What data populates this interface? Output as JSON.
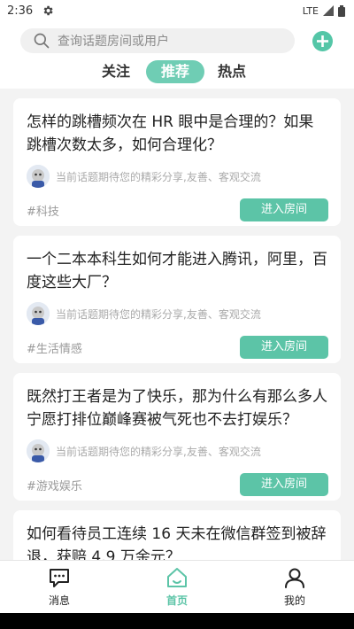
{
  "status_bar": {
    "time": "2:36",
    "network": "LTE"
  },
  "search": {
    "placeholder": "查询话题房间或用户"
  },
  "tabs": [
    {
      "label": "关注",
      "active": false
    },
    {
      "label": "推荐",
      "active": true
    },
    {
      "label": "热点",
      "active": false
    }
  ],
  "cards": [
    {
      "title": "怎样的跳槽频次在 HR 眼中是合理的？如果跳槽次数太多，如何合理化？",
      "hint": "当前话题期待您的精彩分享,友善、客观交流",
      "tag": "#科技",
      "button": "进入房间"
    },
    {
      "title": "一个二本本科生如何才能进入腾讯，阿里，百度这些大厂？",
      "hint": "当前话题期待您的精彩分享,友善、客观交流",
      "tag": "#生活情感",
      "button": "进入房间"
    },
    {
      "title": "既然打王者是为了快乐，那为什么有那么多人宁愿打排位巅峰赛被气死也不去打娱乐？",
      "hint": "当前话题期待您的精彩分享,友善、客观交流",
      "tag": "#游戏娱乐",
      "button": "进入房间"
    },
    {
      "title": "如何看待员工连续 16 天未在微信群签到被辞退，获赔 4.9 万余元？",
      "hint": "",
      "tag": "",
      "button": ""
    }
  ],
  "bottom_nav": [
    {
      "label": "消息",
      "icon": "message-icon",
      "active": false
    },
    {
      "label": "首页",
      "icon": "home-icon",
      "active": true
    },
    {
      "label": "我的",
      "icon": "profile-icon",
      "active": false
    }
  ],
  "colors": {
    "accent": "#5cc4a7",
    "tab_active_bg": "#6fcdb4",
    "background": "#f3f3f3"
  }
}
